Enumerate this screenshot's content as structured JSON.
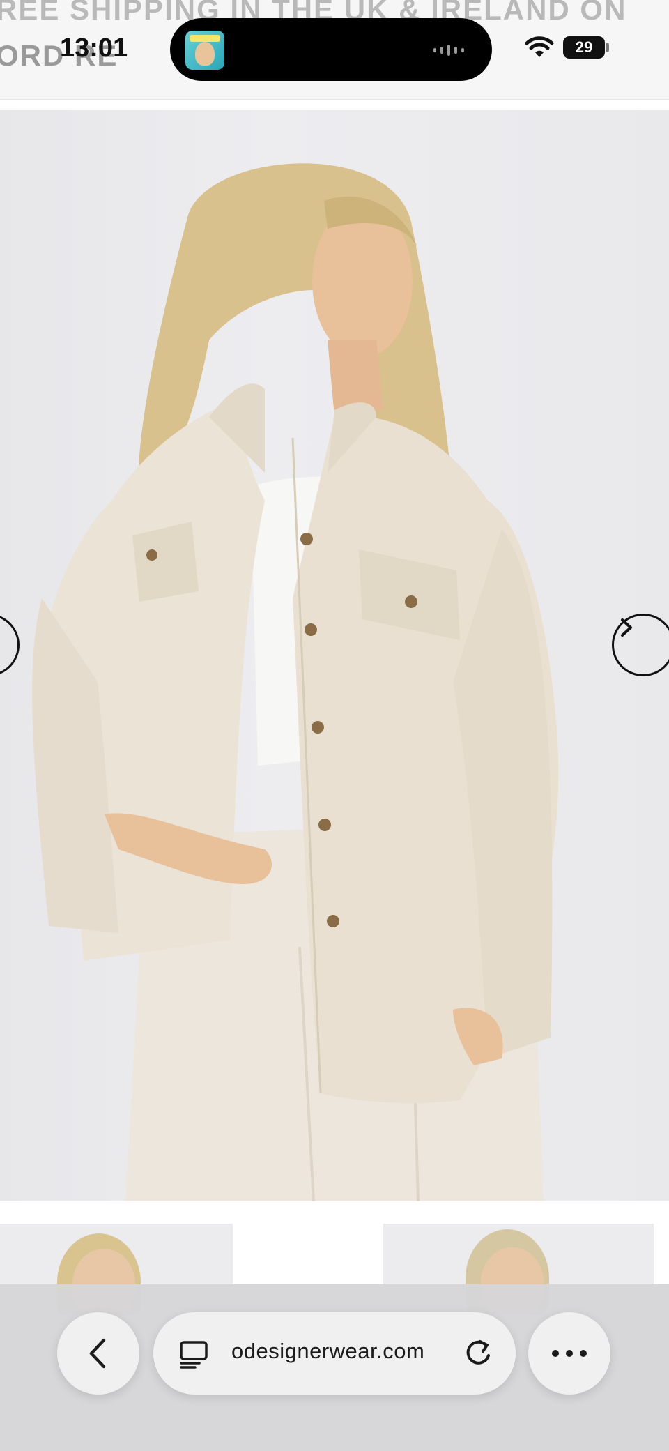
{
  "status_bar": {
    "time": "13:01",
    "battery": "29"
  },
  "promo_banner": {
    "line1": "REE SHIPPING IN THE UK & IRELAND ON",
    "line2": "ORD                                                 RE"
  },
  "product": {
    "image_alt": "Model wearing beige oversized utility shirt with matching trousers"
  },
  "browser": {
    "url": "odesignerwear.com"
  },
  "icons": {
    "back": "chevron-left-icon",
    "reader": "reader-icon",
    "reload": "reload-icon",
    "more": "more-icon",
    "carousel_next": "chevron-right-icon",
    "carousel_prev": "chevron-left-icon"
  }
}
